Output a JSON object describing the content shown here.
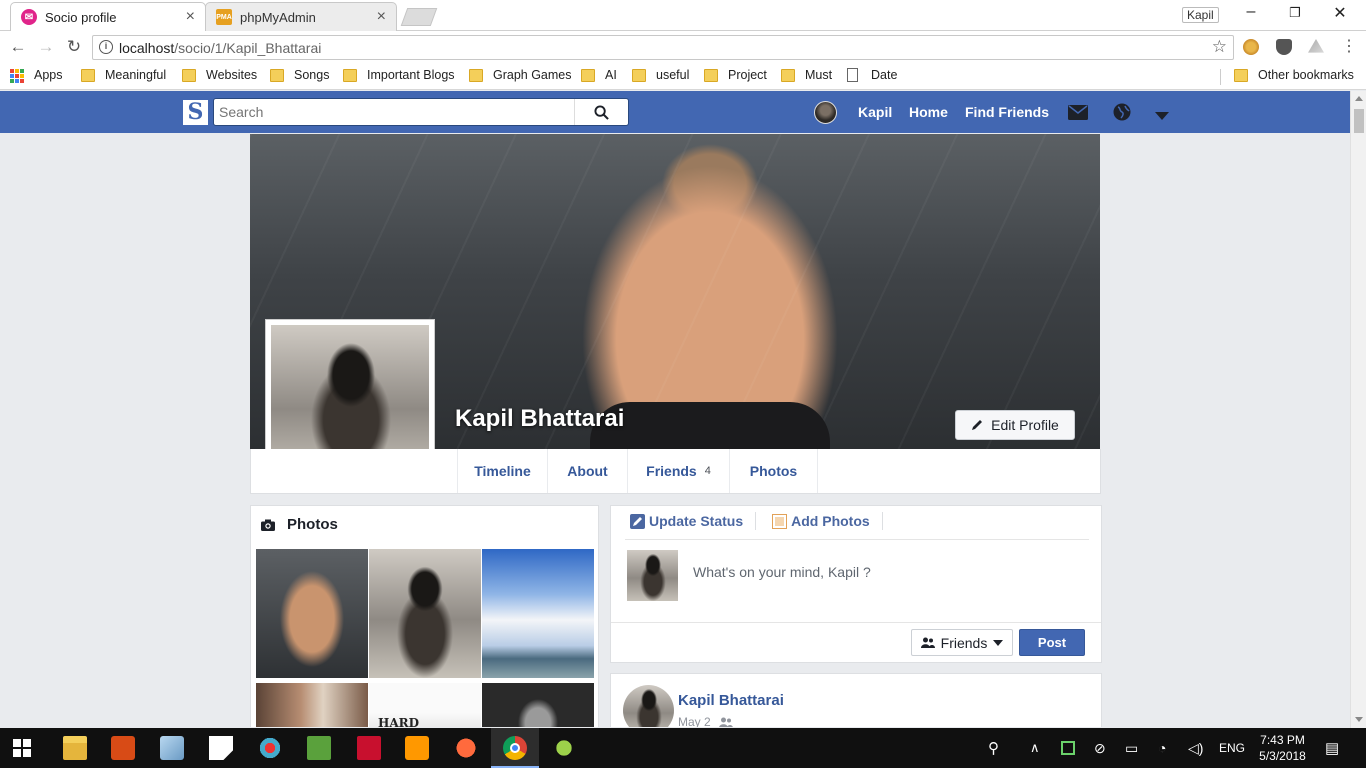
{
  "browser": {
    "tabs": [
      {
        "title": "Socio profile",
        "favicon_color": "#e0248a",
        "active": true
      },
      {
        "title": "phpMyAdmin",
        "favicon_color": "#e6a020",
        "active": false
      }
    ],
    "user_label": "Kapil",
    "address": {
      "host": "localhost",
      "path": "/socio/1/Kapil_Bhattarai"
    },
    "bookmarks": [
      "Apps",
      "Meaningful",
      "Websites",
      "Songs",
      "Important Blogs",
      "Graph Games",
      "AI",
      "useful",
      "Project",
      "Must",
      "Date"
    ],
    "other_bookmarks": "Other bookmarks"
  },
  "header": {
    "logo_letter": "S",
    "search_placeholder": "Search",
    "user_name": "Kapil",
    "home_label": "Home",
    "find_friends_label": "Find Friends",
    "icons": [
      "envelope-icon",
      "globe-icon",
      "caret-down-icon"
    ],
    "brand_color": "#4267b2"
  },
  "profile": {
    "name": "Kapil Bhattarai",
    "edit_label": "Edit Profile",
    "tabs": {
      "timeline": "Timeline",
      "about": "About",
      "friends": "Friends",
      "friends_count": "4",
      "photos": "Photos"
    }
  },
  "photos_panel": {
    "title": "Photos",
    "thumb5_text": "HARD"
  },
  "composer": {
    "update_status": "Update Status",
    "add_photos": "Add Photos",
    "placeholder": "What's on your mind, Kapil ?",
    "privacy": "Friends",
    "post_label": "Post"
  },
  "post": {
    "author": "Kapil Bhattarai",
    "date": "May 2"
  },
  "taskbar": {
    "language": "ENG",
    "time": "7:43 PM",
    "date": "5/3/2018"
  }
}
